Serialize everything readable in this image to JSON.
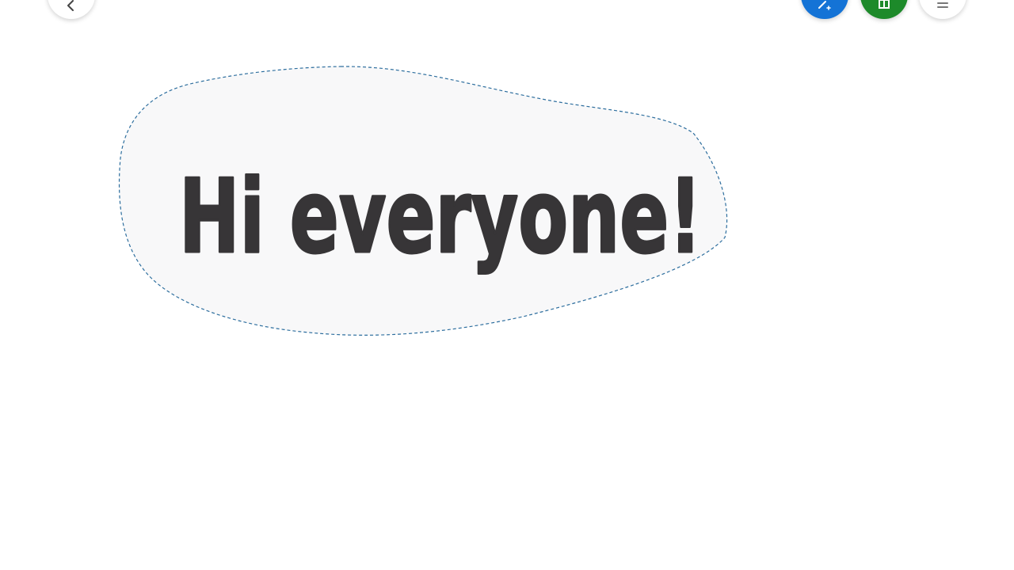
{
  "canvas": {
    "ink_text": "Hi everyone!",
    "ink_color": "#373537",
    "lasso_color": "#2d6e9e",
    "selection_fill": "#f8f8f9"
  },
  "toolbar": {
    "back_icon": "chevron-left-icon",
    "add_ink_icon": "pen-plus-icon",
    "add_ink_color": "#1473d6",
    "collab_icon": "sheet-icon",
    "collab_color": "#1d8a2a",
    "menu_icon": "hamburger-icon"
  }
}
